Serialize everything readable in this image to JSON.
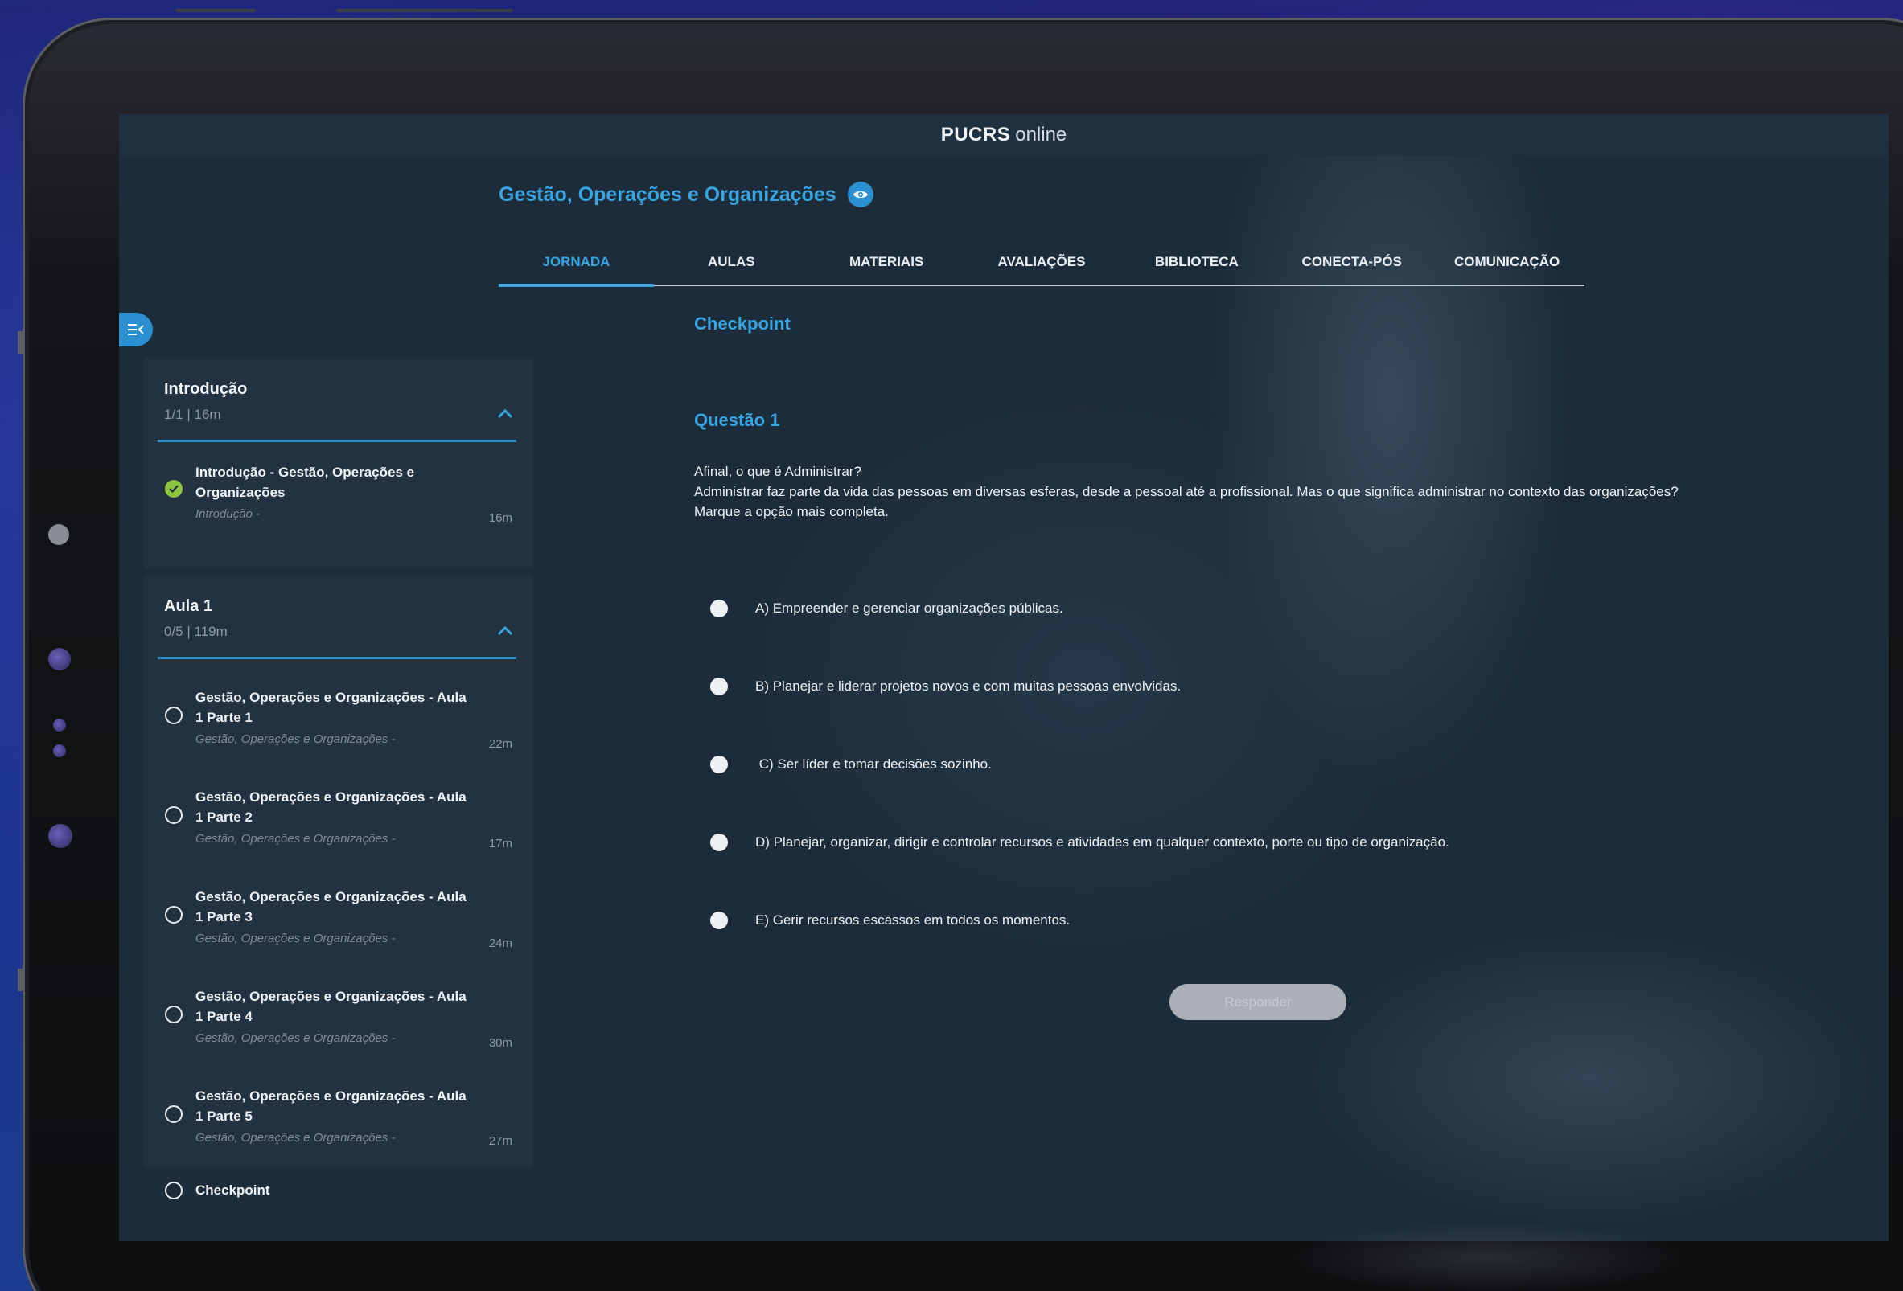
{
  "app": {
    "brand_bold": "PUCRS",
    "brand_light": "online"
  },
  "course": {
    "title": "Gestão, Operações e Organizações"
  },
  "tabs": [
    {
      "label": "JORNADA",
      "active": true
    },
    {
      "label": "AULAS",
      "active": false
    },
    {
      "label": "MATERIAIS",
      "active": false
    },
    {
      "label": "AVALIAÇÕES",
      "active": false
    },
    {
      "label": "BIBLIOTECA",
      "active": false
    },
    {
      "label": "CONECTA-PÓS",
      "active": false
    },
    {
      "label": "COMUNICAÇÃO",
      "active": false
    }
  ],
  "sidebar": {
    "sections": [
      {
        "title": "Introdução",
        "meta": "1/1 | 16m",
        "items": [
          {
            "title": "Introdução - Gestão, Operações e Organizações",
            "subtitle": "Introdução -",
            "duration": "16m",
            "completed": true
          }
        ]
      },
      {
        "title": "Aula 1",
        "meta": "0/5 | 119m",
        "items": [
          {
            "title": "Gestão, Operações e Organizações - Aula 1 Parte 1",
            "subtitle": "Gestão, Operações e Organizações -",
            "duration": "22m",
            "completed": false
          },
          {
            "title": "Gestão, Operações e Organizações - Aula 1 Parte 2",
            "subtitle": "Gestão, Operações e Organizações -",
            "duration": "17m",
            "completed": false
          },
          {
            "title": "Gestão, Operações e Organizações - Aula 1 Parte 3",
            "subtitle": "Gestão, Operações e Organizações -",
            "duration": "24m",
            "completed": false
          },
          {
            "title": "Gestão, Operações e Organizações - Aula 1 Parte 4",
            "subtitle": "Gestão, Operações e Organizações -",
            "duration": "30m",
            "completed": false
          },
          {
            "title": "Gestão, Operações e Organizações - Aula 1 Parte 5",
            "subtitle": "Gestão, Operações e Organizações -",
            "duration": "27m",
            "completed": false
          }
        ]
      }
    ],
    "checkpoint_item": {
      "title": "Checkpoint",
      "completed": false
    }
  },
  "main": {
    "heading": "Checkpoint",
    "question_title": "Questão 1",
    "question_lines": [
      "Afinal, o que é Administrar?",
      "Administrar faz parte da vida das pessoas em diversas esferas, desde a pessoal até a profissional. Mas o que significa administrar no contexto das organizações?",
      "Marque a opção mais completa."
    ],
    "options": [
      {
        "label": "A) Empreender e gerenciar organizações públicas."
      },
      {
        "label": "B) Planejar e liderar projetos novos e com muitas pessoas envolvidas."
      },
      {
        "label": " C) Ser líder e tomar decisões sozinho."
      },
      {
        "label": "D) Planejar, organizar, dirigir e controlar recursos e atividades em qualquer contexto, porte ou tipo de organização."
      },
      {
        "label": "E) Gerir recursos escassos em todos os momentos."
      }
    ],
    "submit_label": "Responder"
  },
  "colors": {
    "accent": "#3aa4e0",
    "screen_bg": "#1d2c3a",
    "panel_bg": "#223241",
    "completed": "#8cc63f"
  }
}
